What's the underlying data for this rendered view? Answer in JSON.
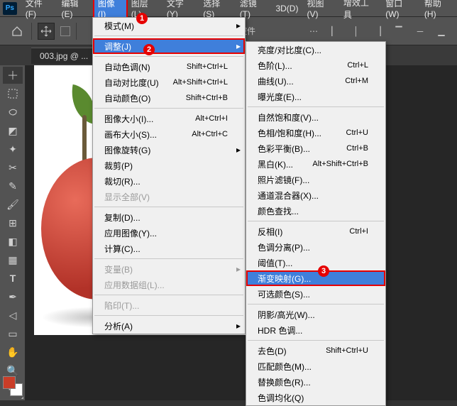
{
  "logo": "Ps",
  "menubar": [
    "文件(F)",
    "编辑(E)",
    "图像(I)",
    "图层(L)",
    "文字(Y)",
    "选择(S)",
    "滤镜(T)",
    "3D(D)",
    "视图(V)",
    "增效工具",
    "窗口(W)",
    "帮助(H)"
  ],
  "optbar_text": "控件",
  "tab": "003.jpg @ ...",
  "badges": [
    "1",
    "2",
    "3"
  ],
  "dd1": {
    "mode": "模式(M)",
    "adjust": "调整(J)",
    "autoTone": {
      "l": "自动色调(N)",
      "s": "Shift+Ctrl+L"
    },
    "autoContrast": {
      "l": "自动对比度(U)",
      "s": "Alt+Shift+Ctrl+L"
    },
    "autoColor": {
      "l": "自动颜色(O)",
      "s": "Shift+Ctrl+B"
    },
    "imgSize": {
      "l": "图像大小(I)...",
      "s": "Alt+Ctrl+I"
    },
    "canvSize": {
      "l": "画布大小(S)...",
      "s": "Alt+Ctrl+C"
    },
    "rotate": "图像旋转(G)",
    "crop": "裁剪(P)",
    "trim": "裁切(R)...",
    "reveal": "显示全部(V)",
    "dup": "复制(D)...",
    "apply": "应用图像(Y)...",
    "calc": "计算(C)...",
    "vars": "变量(B)",
    "dataset": "应用数据组(L)...",
    "trap": "陷印(T)...",
    "analyze": "分析(A)"
  },
  "dd2": {
    "bc": "亮度/对比度(C)...",
    "levels": {
      "l": "色阶(L)...",
      "s": "Ctrl+L"
    },
    "curves": {
      "l": "曲线(U)...",
      "s": "Ctrl+M"
    },
    "exposure": "曝光度(E)...",
    "vib": "自然饱和度(V)...",
    "hue": {
      "l": "色相/饱和度(H)...",
      "s": "Ctrl+U"
    },
    "colbal": {
      "l": "色彩平衡(B)...",
      "s": "Ctrl+B"
    },
    "bw": {
      "l": "黑白(K)...",
      "s": "Alt+Shift+Ctrl+B"
    },
    "photo": "照片滤镜(F)...",
    "chmix": "通道混合器(X)...",
    "collook": "颜色查找...",
    "invert": {
      "l": "反相(I)",
      "s": "Ctrl+I"
    },
    "poster": "色调分离(P)...",
    "thresh": "阈值(T)...",
    "gmap": "渐变映射(G)...",
    "selcol": "可选颜色(S)...",
    "shhl": "阴影/高光(W)...",
    "hdr": "HDR 色调...",
    "desat": {
      "l": "去色(D)",
      "s": "Shift+Ctrl+U"
    },
    "match": "匹配颜色(M)...",
    "replace": "替换颜色(R)...",
    "equal": "色调均化(Q)"
  }
}
